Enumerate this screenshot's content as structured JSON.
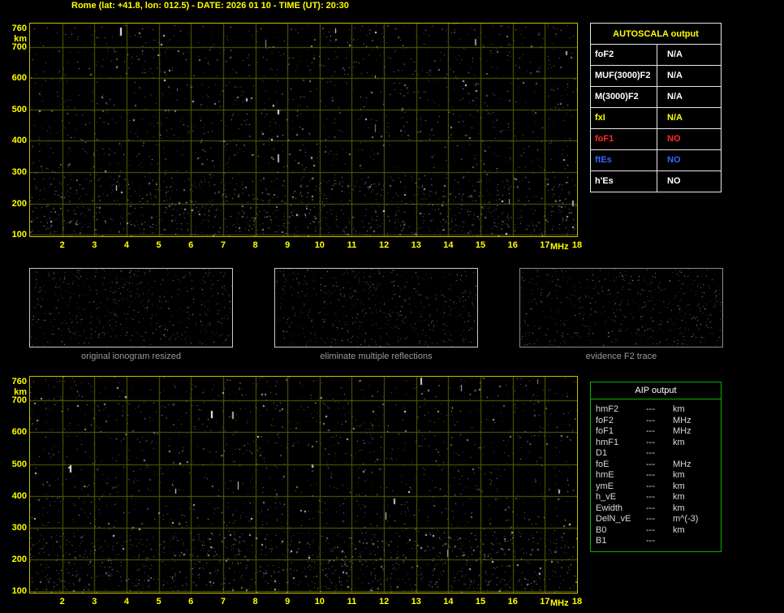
{
  "title": "Rome (lat: +41.8, lon: 012.5) - DATE: 2026 01 10 - TIME (UT): 20:30",
  "colors": {
    "background": "#000000",
    "accent_yellow": "#ffff00",
    "grid": "#5e5e00",
    "plot_border": "#c0c000",
    "autoscala_border": "#e6e6e6",
    "aip_border": "#00b400",
    "caption_gray": "#9a9a9a",
    "fof1_red": "#ff2a2a",
    "ftes_blue": "#3366ff"
  },
  "ionogram": {
    "y_unit": "km",
    "y_ticks": [
      760,
      700,
      600,
      500,
      400,
      300,
      200,
      100
    ],
    "x_ticks": [
      2,
      3,
      4,
      5,
      6,
      7,
      8,
      9,
      10,
      11,
      12,
      13,
      14,
      15,
      16,
      17
    ],
    "x_unit": "MHz",
    "x_last": 18,
    "x_range": [
      1,
      18
    ],
    "y_range": [
      95,
      775
    ]
  },
  "autoscala_table": {
    "header": "AUTOSCALA output",
    "rows": [
      {
        "label": "foF2",
        "value": "N/A",
        "color": "#ffffff"
      },
      {
        "label": "MUF(3000)F2",
        "value": "N/A",
        "color": "#ffffff"
      },
      {
        "label": "M(3000)F2",
        "value": "N/A",
        "color": "#ffffff"
      },
      {
        "label": "fxI",
        "value": "N/A",
        "color": "#ffff00"
      },
      {
        "label": "foF1",
        "value": "NO",
        "color": "#ff2a2a"
      },
      {
        "label": "ftEs",
        "value": "NO",
        "color": "#3366ff"
      },
      {
        "label": "h'Es",
        "value": "NO",
        "color": "#ffffff"
      }
    ]
  },
  "panels": [
    {
      "caption": "original ionogram resized"
    },
    {
      "caption": "eliminate multiple reflections"
    },
    {
      "caption": "evidence F2 trace"
    }
  ],
  "aip_table": {
    "header": "AIP output",
    "rows": [
      {
        "label": "hmF2",
        "value": "---",
        "unit": "km"
      },
      {
        "label": "foF2",
        "value": "---",
        "unit": "MHz"
      },
      {
        "label": "foF1",
        "value": "---",
        "unit": "MHz"
      },
      {
        "label": "hmF1",
        "value": "---",
        "unit": "km"
      },
      {
        "label": "D1",
        "value": "---",
        "unit": ""
      },
      {
        "label": "foE",
        "value": "---",
        "unit": "MHz"
      },
      {
        "label": "hmE",
        "value": "---",
        "unit": "km"
      },
      {
        "label": "ymE",
        "value": "---",
        "unit": "km"
      },
      {
        "label": "h_vE",
        "value": "---",
        "unit": "km"
      },
      {
        "label": "Ewidth",
        "value": "---",
        "unit": "km"
      },
      {
        "label": "DelN_vE",
        "value": "---",
        "unit": "m^(-3)"
      },
      {
        "label": "B0",
        "value": "---",
        "unit": "km"
      },
      {
        "label": "B1",
        "value": "---",
        "unit": ""
      }
    ]
  }
}
